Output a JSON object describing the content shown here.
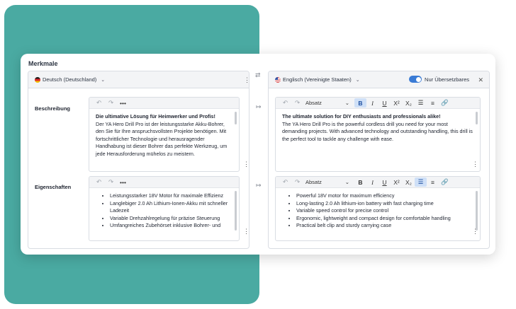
{
  "card": {
    "title": "Merkmale"
  },
  "left_panel": {
    "language": "Deutsch (Deutschland)",
    "rows": [
      {
        "label": "Beschreibung",
        "heading": "Die ultimative Lösung für Heimwerker und Profis!",
        "text": "Der YA Hero Drill Pro ist der leistungsstarke Akku-Bohrer, den Sie für Ihre anspruchsvollsten Projekte benötigen. Mit fortschrittlicher Technologie und herausragender Handhabung ist dieser Bohrer das perfekte Werkzeug, um jede Herausforderung mühelos zu meistern."
      },
      {
        "label": "Eigenschaften",
        "bullets": [
          "Leistungsstarker 18V Motor für maximale Effizienz",
          "Langlebiger 2.0 Ah Lithium-Ionen-Akku mit schneller Ladezeit",
          "Variable Drehzahlregelung für präzise Steuerung",
          "Umfangreiches Zubehörset inklusive Bohrer- und"
        ]
      }
    ]
  },
  "right_panel": {
    "language": "Englisch (Vereinigte Staaten)",
    "toggle_label": "Nur Übersetzbares",
    "toggle_on": true,
    "paragraph_style": "Absatz",
    "rows": [
      {
        "heading": "The ultimate solution for DIY enthusiasts and professionals alike!",
        "text": "The YA Hero Drill Pro is the powerful cordless drill you need for your most demanding projects. With advanced technology and outstanding handling, this drill is the perfect tool to tackle any challenge with ease."
      },
      {
        "bullets": [
          "Powerful 18V motor for maximum efficiency",
          "Long-lasting 2.0 Ah lithium-ion battery with fast charging time",
          "Variable speed control for precise control",
          "Ergonomic, lightweight and compact design for comfortable handling",
          "Practical belt clip and sturdy carrying case"
        ]
      }
    ]
  },
  "toolbar": {
    "undo": "↶",
    "redo": "↷",
    "more": "•••",
    "bold": "B",
    "italic": "I",
    "underline": "U",
    "superscript": "X²",
    "subscript": "X₂",
    "link": "🔗"
  },
  "icons": {
    "swap": "⇄",
    "copy_arrow": "↦",
    "kebab": "⋮",
    "close": "✕",
    "chevron": "⌄"
  },
  "colors": {
    "teal_background": "#4aaaa2",
    "accent": "#3a7bd5",
    "active_button": "#cfe0f7"
  }
}
